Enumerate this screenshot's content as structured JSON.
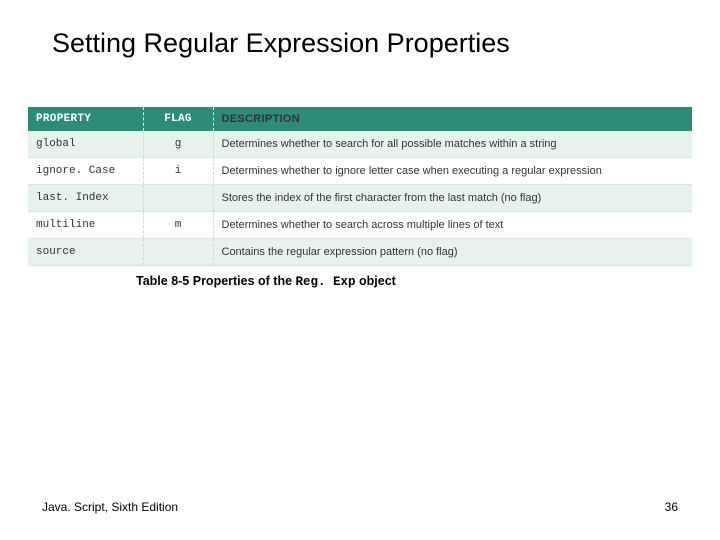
{
  "title": "Setting Regular Expression Properties",
  "table": {
    "headers": {
      "property": "PROPERTY",
      "flag": "FLAG",
      "description": "DESCRIPTION"
    },
    "rows": [
      {
        "property": "global",
        "flag": "g",
        "description": "Determines whether to search for all possible matches within a string"
      },
      {
        "property": "ignore. Case",
        "flag": "i",
        "description": "Determines whether to ignore letter case when executing a regular expression"
      },
      {
        "property": "last. Index",
        "flag": "",
        "description": "Stores the index of the first character from the last match (no flag)"
      },
      {
        "property": "multiline",
        "flag": "m",
        "description": "Determines whether to search across multiple lines of text"
      },
      {
        "property": "source",
        "flag": "",
        "description": "Contains the regular expression pattern (no flag)"
      }
    ]
  },
  "caption": {
    "prefix": "Table 8-5 Properties of the ",
    "code": "Reg. Exp",
    "suffix": " object"
  },
  "footer": {
    "left": "Java. Script, Sixth Edition",
    "right": "36"
  }
}
